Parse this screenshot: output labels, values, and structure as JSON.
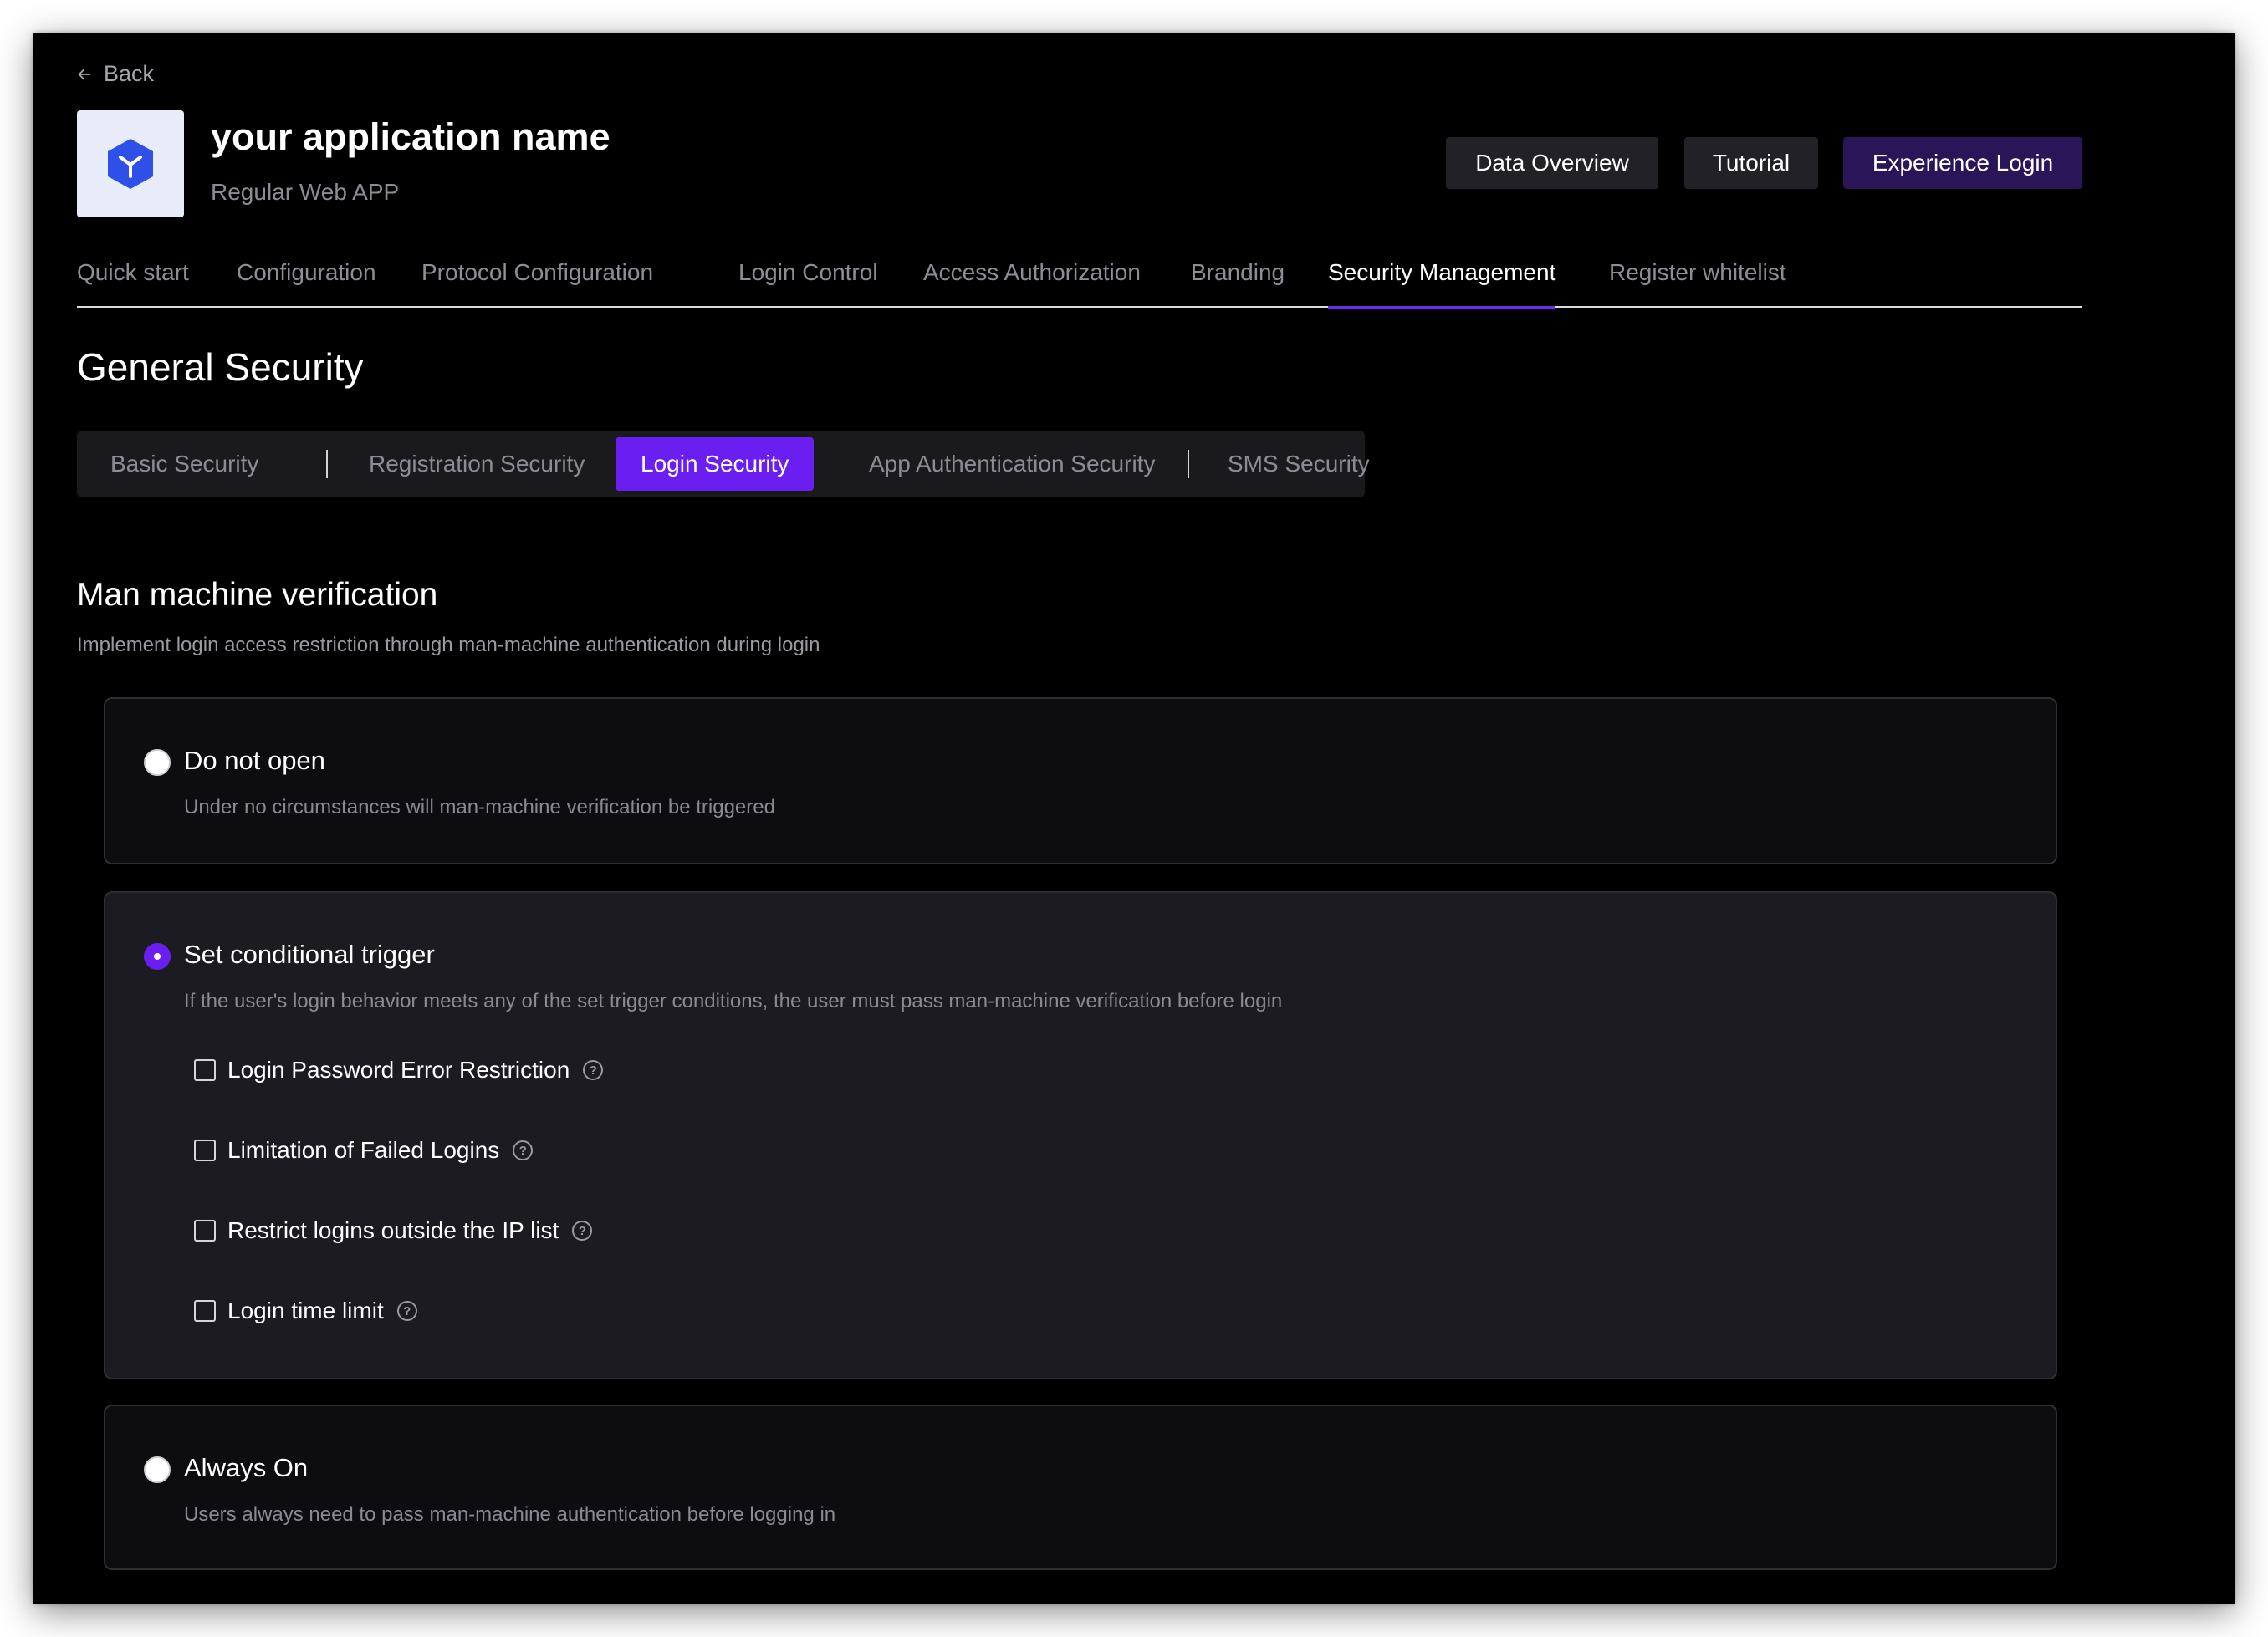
{
  "back": {
    "label": "Back"
  },
  "app": {
    "name": "your application name",
    "type": "Regular Web APP",
    "icon": "cube-icon"
  },
  "header_buttons": {
    "data_overview": "Data Overview",
    "tutorial": "Tutorial",
    "experience_login": "Experience Login"
  },
  "tabs": [
    {
      "label": "Quick start"
    },
    {
      "label": "Configuration"
    },
    {
      "label": "Protocol Configuration"
    },
    {
      "label": "Login Control"
    },
    {
      "label": "Access Authorization"
    },
    {
      "label": "Branding"
    },
    {
      "label": "Security Management",
      "active": true
    },
    {
      "label": "Register whitelist"
    }
  ],
  "section_title": "General Security",
  "security_tabs": [
    {
      "label": "Basic Security"
    },
    {
      "label": "Registration Security"
    },
    {
      "label": "Login Security",
      "active": true
    },
    {
      "label": "App Authentication Security"
    },
    {
      "label": "SMS Security"
    }
  ],
  "verification": {
    "title": "Man machine verification",
    "description": "Implement login access restriction through man-machine authentication during login",
    "options": [
      {
        "label": "Do not open",
        "description": "Under no circumstances will man-machine verification be triggered",
        "selected": false
      },
      {
        "label": "Set conditional trigger",
        "description": "If the user's login behavior meets any of the set trigger conditions, the user must pass man-machine verification before login",
        "selected": true,
        "conditions": [
          {
            "label": "Login Password Error Restriction",
            "checked": false
          },
          {
            "label": "Limitation of Failed Logins",
            "checked": false
          },
          {
            "label": "Restrict logins outside the IP list",
            "checked": false
          },
          {
            "label": "Login time limit",
            "checked": false
          }
        ]
      },
      {
        "label": "Always On",
        "description": "Users always need to pass man-machine authentication before logging in",
        "selected": false
      }
    ]
  },
  "colors": {
    "accent": "#6a1ff0",
    "background": "#000000",
    "card_selected": "#1c1b21"
  }
}
